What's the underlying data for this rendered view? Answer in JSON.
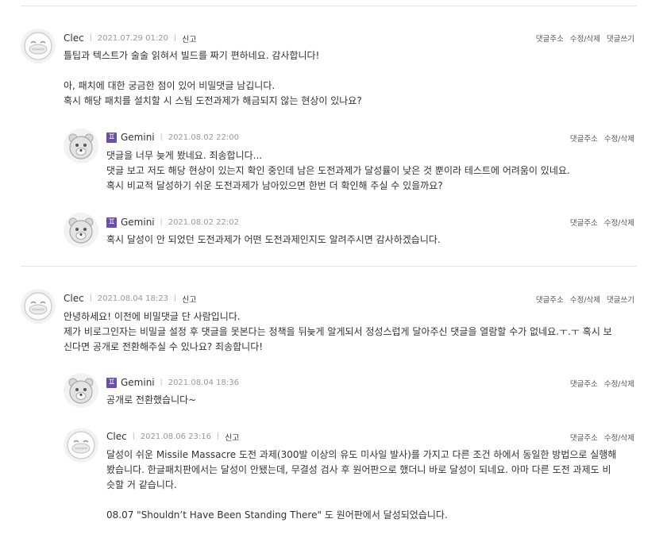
{
  "actions": {
    "reply_address": "댓글주소",
    "edit_delete": "수정/삭제",
    "write_reply": "댓글쓰기"
  },
  "comments": [
    {
      "author": "Clec",
      "date": "2021.07.29 01:20",
      "report": "신고",
      "lines": [
        "틀팁과 텍스트가 술술 읽혀서 빌드를 짜기 편하네요. 감사합니다!",
        "",
        "아, 패치에 대한 궁금한 점이 있어 비밀댓글 남깁니다.",
        "혹시 해당 패치를 설치할 시 스팀 도전과제가 해금되지 않는 현상이 있나요?"
      ]
    },
    {
      "author": "Gemini",
      "date": "2021.08.02 22:00",
      "lines": [
        "댓글을 너무 늦게 봤네요. 죄송합니다...",
        "댓글 보고 저도 해당 현상이 있는지 확인 중인데 남은 도전과제가 달성률이 낮은 것 뿐이라 테스트에 어려움이 있네요.",
        "혹시 비교적 달성하기 쉬운 도전과제가 남아있으면 한번 더 확인해 주실 수 있을까요?"
      ]
    },
    {
      "author": "Gemini",
      "date": "2021.08.02 22:02",
      "lines": [
        "혹시 달성이 안 되었던 도전과제가 어떤 도전과제인지도 알려주시면 감사하겠습니다."
      ]
    },
    {
      "author": "Clec",
      "date": "2021.08.04 18:23",
      "report": "신고",
      "lines": [
        "안녕하세요! 이전에 비밀댓글 단 사람입니다.",
        "제가 비로그인자는 비밀글 설정 후 댓글을 못본다는 정책을 뒤늦게 알게되서 정성스럽게 달아주신 댓글을 열람할 수가 없네요.ㅜ.ㅜ 혹시 보",
        "신다면 공개로 전환해주실 수 있나요? 죄송합니다!"
      ]
    },
    {
      "author": "Gemini",
      "date": "2021.08.04 18:36",
      "lines": [
        "공개로 전환했습니다~"
      ]
    },
    {
      "author": "Clec",
      "date": "2021.08.06 23:16",
      "report": "신고",
      "lines": [
        "달성이 쉬운 Missile Massacre 도전 과제(300발 이상의 유도 미사일 발사)를 가지고 다른 조건 하에서 동일한 방법으로 실행해",
        "봤습니다. 한글패치판에서는 달성이 안됐는데, 무결성 검사 후 원어판으로 했더니 바로 달성이 되네요. 아마 다른 도전 과제도 비",
        "슷할 거 같습니다.",
        "",
        "08.07 \"Shouldn’t Have Been Standing There\" 도 원어판에서 달성되었습니다."
      ]
    }
  ]
}
